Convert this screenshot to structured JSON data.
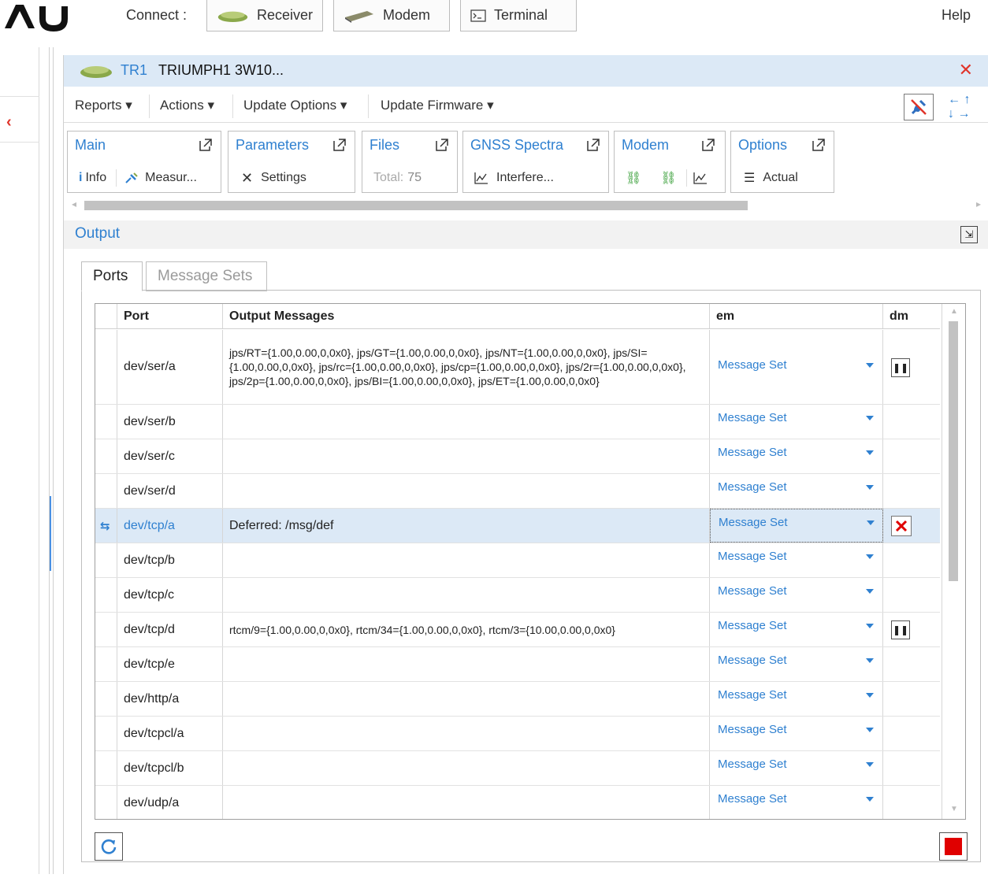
{
  "topbar": {
    "connect_label": "Connect :",
    "buttons": [
      {
        "label": "Receiver",
        "icon": "receiver-icon"
      },
      {
        "label": "Modem",
        "icon": "modem-icon"
      },
      {
        "label": "Terminal",
        "icon": "terminal-icon"
      }
    ],
    "help": "Help"
  },
  "panel": {
    "device_id": "TR1",
    "device_title": "TRIUMPH1  3W10...",
    "close_icon": "close-icon"
  },
  "menu": {
    "items": [
      "Reports",
      "Actions",
      "Update Options",
      "Update Firmware"
    ]
  },
  "cards": [
    {
      "title": "Main",
      "sub": [
        "Info",
        "Measur..."
      ]
    },
    {
      "title": "Parameters",
      "sub": [
        "Settings"
      ]
    },
    {
      "title": "Files",
      "sub_label": "Total:",
      "sub_value": "75"
    },
    {
      "title": "GNSS Spectra",
      "sub": [
        "Interfere..."
      ]
    },
    {
      "title": "Modem",
      "sub": []
    },
    {
      "title": "Options",
      "sub": [
        "Actual"
      ]
    }
  ],
  "output": {
    "title": "Output",
    "tabs": [
      "Ports",
      "Message Sets"
    ],
    "active_tab": "Ports"
  },
  "grid": {
    "columns": [
      "Port",
      "Output Messages",
      "em",
      "dm"
    ],
    "em_value": "Message Set",
    "rows": [
      {
        "port": "dev/ser/a",
        "messages": "jps/RT={1.00,0.00,0,0x0}, jps/GT={1.00,0.00,0,0x0}, jps/NT={1.00,0.00,0,0x0}, jps/SI={1.00,0.00,0,0x0}, jps/rc={1.00,0.00,0,0x0}, jps/cp={1.00,0.00,0,0x0}, jps/2r={1.00,0.00,0,0x0}, jps/2p={1.00,0.00,0,0x0}, jps/BI={1.00,0.00,0,0x0}, jps/ET={1.00,0.00,0,0x0}",
        "dm": "pause"
      },
      {
        "port": "dev/ser/b",
        "messages": "",
        "dm": ""
      },
      {
        "port": "dev/ser/c",
        "messages": "",
        "dm": ""
      },
      {
        "port": "dev/ser/d",
        "messages": "",
        "dm": ""
      },
      {
        "port": "dev/tcp/a",
        "messages": "Deferred: /msg/def",
        "dm": "remove",
        "selected": true
      },
      {
        "port": "dev/tcp/b",
        "messages": "",
        "dm": ""
      },
      {
        "port": "dev/tcp/c",
        "messages": "",
        "dm": ""
      },
      {
        "port": "dev/tcp/d",
        "messages": "rtcm/9={1.00,0.00,0,0x0}, rtcm/34={1.00,0.00,0,0x0}, rtcm/3={10.00,0.00,0,0x0}",
        "dm": "pause"
      },
      {
        "port": "dev/tcp/e",
        "messages": "",
        "dm": ""
      },
      {
        "port": "dev/http/a",
        "messages": "",
        "dm": ""
      },
      {
        "port": "dev/tcpcl/a",
        "messages": "",
        "dm": ""
      },
      {
        "port": "dev/tcpcl/b",
        "messages": "",
        "dm": ""
      },
      {
        "port": "dev/udp/a",
        "messages": "",
        "dm": ""
      }
    ]
  },
  "colors": {
    "accent": "#2f80d0",
    "danger": "#e0342a",
    "header_bg": "#dce9f6"
  }
}
